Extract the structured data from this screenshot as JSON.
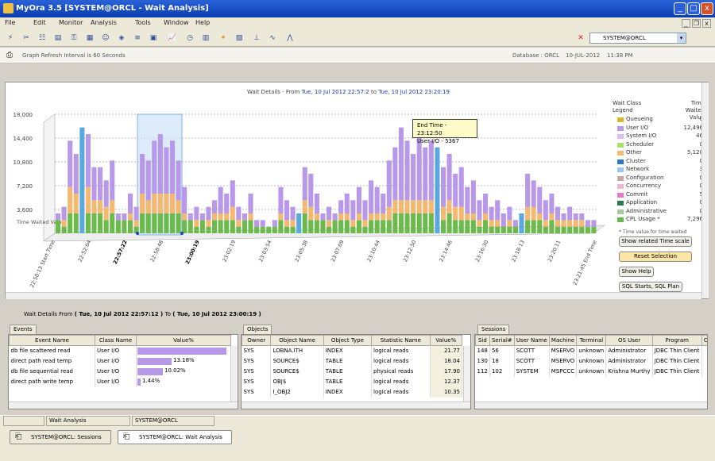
{
  "window": {
    "title": "MyOra 3.5  [SYSTEM@ORCL  - Wait Analysis]",
    "minimize": "_",
    "maximize": "□",
    "close": "x"
  },
  "menu": {
    "items": [
      "File",
      "Edit",
      "Monitor",
      "Analysis",
      "Tools",
      "Window",
      "Help"
    ],
    "doc_minimize": "_",
    "doc_restore": "❐",
    "doc_close": "x"
  },
  "toolbar": {
    "connection": "SYSTEM@ORCL"
  },
  "info": {
    "refresh": "Graph Refresh Interval is 60 Seconds",
    "database": "Database : ORCL",
    "date": "10-JUL-2012",
    "time": "11:38 PM"
  },
  "chart": {
    "header_prefix": "Wait Details - From",
    "from": "Tue, 10 Jul 2012 22:57:2",
    "to_label": "to",
    "to": "Tue, 10 Jul 2012 23:20:19",
    "tooltip_line1": "End Time - 23:12:50",
    "tooltip_line2": "User I/O - 5367",
    "y_axis_title": "Time Waited Value",
    "legend_title_left": "Wait Class Legend",
    "legend_title_right": "Time Waited Value",
    "footnote": "* Time value for time waited",
    "buttons": [
      "Show related Time scale",
      "Reset Selection",
      "Show Help",
      "SQL Starts, SQL Plan"
    ]
  },
  "chart_data": {
    "type": "bar",
    "y_ticks": [
      "18,000",
      "14,400",
      "10,800",
      "7,200",
      "3,600"
    ],
    "ylim": [
      0,
      18000
    ],
    "x_labels": [
      "22:50:13 Start Time",
      "22:52:04",
      "22:57:22",
      "22:58:48",
      "23:00:19",
      "23:02:19",
      "23:03:54",
      "23:05:38",
      "23:07:09",
      "23:10:44",
      "23:12:50",
      "23:14:46",
      "23:16:30",
      "23:18:13",
      "23:20:11",
      "23:21:45 End Time"
    ],
    "selected_range": [
      "22:57:22",
      "23:00:19"
    ],
    "series": [
      {
        "name": "Queueing",
        "value": 0,
        "color": "#d8b830"
      },
      {
        "name": "User I/O",
        "value": 12496,
        "color": "#b898e8"
      },
      {
        "name": "System I/O",
        "value": 46,
        "color": "#d8c0f0"
      },
      {
        "name": "Scheduler",
        "value": 0,
        "color": "#a8e068"
      },
      {
        "name": "Other",
        "value": 5120,
        "color": "#f4b870"
      },
      {
        "name": "Cluster",
        "value": 0,
        "color": "#2a78c8"
      },
      {
        "name": "Network",
        "value": 3,
        "color": "#9ac8f0"
      },
      {
        "name": "Configuration",
        "value": 0,
        "color": "#c8a8a0"
      },
      {
        "name": "Concurrency",
        "value": 0,
        "color": "#f0b8d0"
      },
      {
        "name": "Commit",
        "value": 5,
        "color": "#e878c8"
      },
      {
        "name": "Application",
        "value": 0,
        "color": "#2a7850"
      },
      {
        "name": "Administrative",
        "value": 0,
        "color": "#a8c8a0"
      },
      {
        "name": "CPL Usage *",
        "value": 7296,
        "color": "#68b850"
      }
    ],
    "bars_total": [
      3,
      4,
      14,
      12,
      16,
      15,
      10,
      10,
      8,
      11,
      3,
      3,
      6,
      4,
      12,
      11,
      14,
      15,
      13,
      14,
      11,
      7,
      3,
      4,
      3,
      4,
      5,
      7,
      6,
      8,
      4,
      3,
      6,
      2,
      2,
      1,
      2,
      7,
      5,
      4,
      3,
      10,
      9,
      6,
      3,
      4,
      3,
      5,
      6,
      5,
      7,
      5,
      8,
      7,
      6,
      11,
      13,
      16,
      14,
      12,
      15,
      13,
      14,
      13,
      10,
      12,
      9,
      10,
      7,
      8,
      5,
      6,
      4,
      5,
      3,
      4,
      2,
      3,
      9,
      8,
      7,
      5,
      6,
      4,
      3,
      4,
      3,
      3,
      2,
      2
    ],
    "bars_userio": [
      1,
      2,
      7,
      6,
      9,
      8,
      5,
      5,
      4,
      6,
      1,
      1,
      3,
      2,
      6,
      6,
      8,
      9,
      7,
      8,
      6,
      4,
      1,
      2,
      1,
      2,
      2,
      4,
      3,
      4,
      2,
      1,
      3,
      1,
      1,
      0,
      1,
      4,
      3,
      2,
      1,
      5,
      5,
      3,
      1,
      2,
      1,
      2,
      3,
      3,
      4,
      3,
      5,
      4,
      3,
      7,
      8,
      11,
      9,
      7,
      10,
      8,
      9,
      8,
      6,
      7,
      5,
      6,
      4,
      5,
      3,
      3,
      2,
      3,
      2,
      2,
      1,
      1,
      5,
      4,
      4,
      3,
      3,
      2,
      1,
      2,
      1,
      1,
      1,
      1
    ],
    "bars_other": [
      0,
      1,
      4,
      3,
      4,
      4,
      2,
      2,
      2,
      2,
      0,
      0,
      1,
      1,
      3,
      2,
      3,
      3,
      3,
      3,
      2,
      1,
      0,
      1,
      0,
      1,
      1,
      1,
      1,
      2,
      1,
      0,
      1,
      0,
      0,
      0,
      0,
      1,
      1,
      1,
      0,
      2,
      2,
      1,
      0,
      1,
      0,
      1,
      1,
      1,
      1,
      1,
      1,
      1,
      1,
      2,
      2,
      2,
      2,
      2,
      2,
      2,
      2,
      2,
      2,
      2,
      2,
      2,
      1,
      1,
      1,
      1,
      1,
      1,
      0,
      1,
      0,
      1,
      2,
      2,
      1,
      1,
      1,
      1,
      1,
      1,
      1,
      1,
      0,
      0
    ]
  },
  "bottom": {
    "title_prefix": "Wait Details  From",
    "from": "Tue, 10 Jul 2012 22:57:12",
    "to_label": "To",
    "to": "Tue, 10 Jul 2012 23:00:19",
    "events": {
      "tab": "Events",
      "columns": [
        "Event Name",
        "Class Name",
        "Value%"
      ],
      "rows": [
        {
          "name": "db file scattered read",
          "cls": "User I/O",
          "pct": "",
          "frac": 1.0
        },
        {
          "name": "direct path read temp",
          "cls": "User I/O",
          "pct": "13.18%",
          "frac": 0.38
        },
        {
          "name": "db file sequential read",
          "cls": "User I/O",
          "pct": "10.02%",
          "frac": 0.29
        },
        {
          "name": "direct path write temp",
          "cls": "User I/O",
          "pct": "1.44%",
          "frac": 0.04
        }
      ]
    },
    "objects": {
      "tab": "Objects",
      "columns": [
        "Owner",
        "Object Name",
        "Object Type",
        "Statistic Name",
        "Value%"
      ],
      "rows": [
        [
          "SYS",
          "LOBNA.ITH",
          "INDEX",
          "logical reads",
          "21.77"
        ],
        [
          "SYS",
          "SOURCE$",
          "TABLE",
          "logical reads",
          "18.04"
        ],
        [
          "SYS",
          "SOURCE$",
          "TABLE",
          "physical reads",
          "17.90"
        ],
        [
          "SYS",
          "OBJ$",
          "TABLE",
          "logical reads",
          "12.37"
        ],
        [
          "SYS",
          "I_OBJ2",
          "INDEX",
          "logical reads",
          "10.35"
        ]
      ]
    },
    "sessions": {
      "tab": "Sessions",
      "columns": [
        "Sid",
        "Serial#",
        "User Name",
        "Machine",
        "Terminal",
        "OS User",
        "Program",
        "CP"
      ],
      "rows": [
        [
          "148",
          "56",
          "SCOTT",
          "MSERVO",
          "unknown",
          "Administrator",
          "JDBC Thin Client",
          ""
        ],
        [
          "130",
          "18",
          "SCOTT",
          "MSERVO",
          "unknown",
          "Administrator",
          "JDBC Thin Client",
          ""
        ],
        [
          "112",
          "102",
          "SYSTEM",
          "MSPCCC",
          "unknown",
          "Krishna Murthy",
          "JDBC Thin Client",
          ""
        ]
      ]
    }
  },
  "status": {
    "seg1": "",
    "seg2": "Wait Analysis",
    "seg3": "SYSTEM@ORCL"
  },
  "tasks": [
    {
      "label": "SYSTEM@ORCL: Sessions",
      "active": false
    },
    {
      "label": "SYSTEM@ORCL: Wait Analysis",
      "active": true
    }
  ]
}
